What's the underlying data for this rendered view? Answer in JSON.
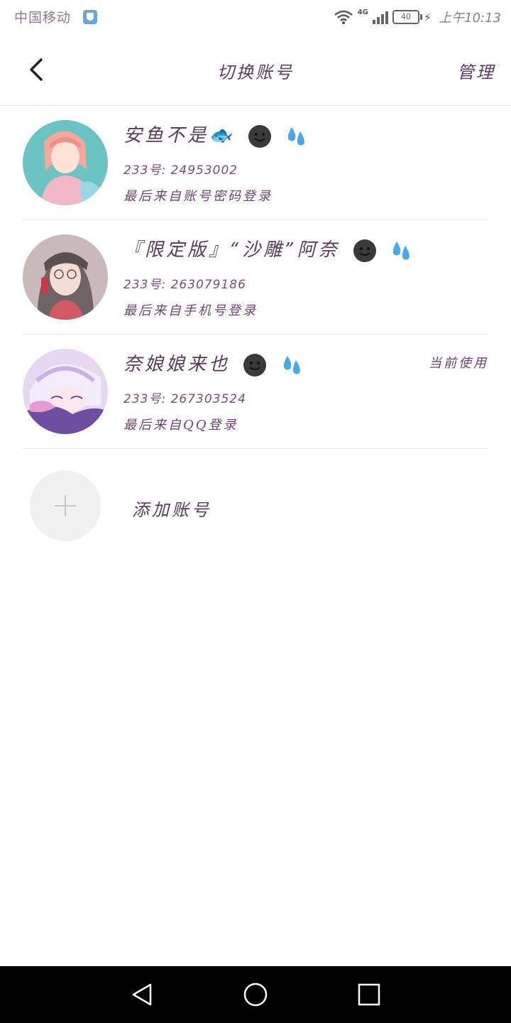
{
  "status": {
    "carrier": "中国移动",
    "network": "4G",
    "battery": "40",
    "time": "上午10:13"
  },
  "header": {
    "title": "切换账号",
    "manage": "管理"
  },
  "accounts": [
    {
      "name": "安鱼不是🐟",
      "id_text": "233号: 24953002",
      "last_login": "最后来自账号密码登录",
      "current": ""
    },
    {
      "name": "『限定版』“沙雕”阿奈",
      "id_text": "233号: 263079186",
      "last_login": "最后来自手机号登录",
      "current": ""
    },
    {
      "name": "奈娘娘来也",
      "id_text": "233号: 267303524",
      "last_login": "最后来自QQ登录",
      "current": "当前使用"
    }
  ],
  "add": {
    "label": "添加账号"
  },
  "icons": {
    "back": "back-arrow-icon",
    "add": "plus-icon",
    "emoji_face": "dark-smiley-icon",
    "emoji_drops": "sweat-drops-icon",
    "nav_back": "nav-back-icon",
    "nav_home": "nav-home-icon",
    "nav_recent": "nav-recent-icon"
  },
  "colors": {
    "text": "#5a3a5e",
    "divider": "#e6e6e6",
    "navbar": "#000000",
    "add_circle": "#f1f1f1"
  }
}
